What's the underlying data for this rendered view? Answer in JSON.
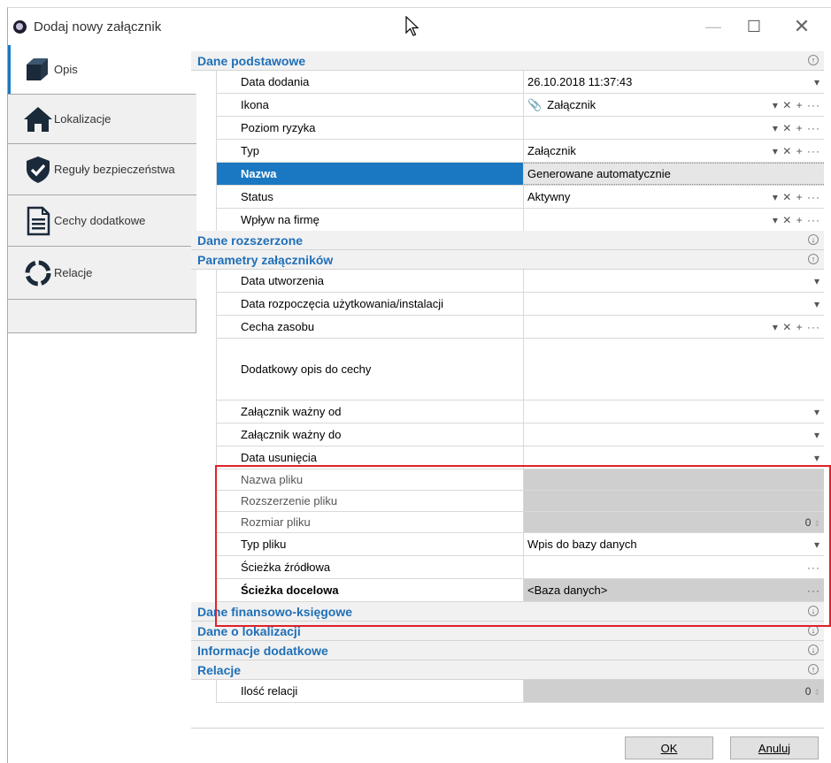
{
  "window": {
    "title": "Dodaj nowy załącznik"
  },
  "nav": {
    "tabs": [
      {
        "label": "Opis",
        "icon": "cube-icon",
        "active": true
      },
      {
        "label": "Lokalizacje",
        "icon": "house-icon",
        "active": false
      },
      {
        "label": "Reguły bezpieczeństwa",
        "icon": "shield-check-icon",
        "active": false
      },
      {
        "label": "Cechy dodatkowe",
        "icon": "document-icon",
        "active": false
      },
      {
        "label": "Relacje",
        "icon": "ring-icon",
        "active": false
      }
    ]
  },
  "groups": {
    "basic": {
      "label": "Dane podstawowe",
      "expanded": true
    },
    "extended": {
      "label": "Dane rozszerzone",
      "expanded": false
    },
    "params": {
      "label": "Parametry załączników",
      "expanded": true
    },
    "finance": {
      "label": "Dane finansowo-księgowe",
      "expanded": false
    },
    "location": {
      "label": "Dane o lokalizacji",
      "expanded": false
    },
    "info": {
      "label": "Informacje dodatkowe",
      "expanded": false
    },
    "relations": {
      "label": "Relacje",
      "expanded": true
    }
  },
  "basic_rows": [
    {
      "name": "Data dodania",
      "value": "26.10.2018 11:37:43"
    },
    {
      "name": "Ikona",
      "value": "Załącznik"
    },
    {
      "name": "Poziom ryzyka",
      "value": ""
    },
    {
      "name": "Typ",
      "value": "Załącznik"
    },
    {
      "name": "Nazwa",
      "value": "Generowane automatycznie"
    },
    {
      "name": "Status",
      "value": "Aktywny"
    },
    {
      "name": "Wpływ na firmę",
      "value": ""
    }
  ],
  "params_rows": [
    {
      "name": "Data utworzenia",
      "value": ""
    },
    {
      "name": "Data rozpoczęcia użytkowania/instalacji",
      "value": ""
    },
    {
      "name": "Cecha zasobu",
      "value": ""
    },
    {
      "name": "Dodatkowy opis do cechy",
      "value": ""
    },
    {
      "name": "Załącznik ważny od",
      "value": ""
    },
    {
      "name": "Załącznik ważny do",
      "value": ""
    },
    {
      "name": "Data usunięcia",
      "value": ""
    },
    {
      "name": "Nazwa pliku",
      "value": ""
    },
    {
      "name": "Rozszerzenie pliku",
      "value": ""
    },
    {
      "name": "Rozmiar pliku",
      "value": "0"
    },
    {
      "name": "Typ pliku",
      "value": "Wpis do bazy danych"
    },
    {
      "name": "Ścieżka źródłowa",
      "value": ""
    },
    {
      "name": "Ścieżka docelowa",
      "value": "<Baza danych>"
    }
  ],
  "relations_rows": [
    {
      "name": "Ilość relacji",
      "value": "0"
    }
  ],
  "controls": {
    "dropdown": "▾",
    "full": "▾ ✕ + ···",
    "ellipsis": "···",
    "spin": "⇕"
  },
  "buttons": {
    "ok": "OK",
    "cancel": "Anuluj"
  },
  "colors": {
    "accent": "#1a78c2",
    "group_text": "#1f6fb8",
    "highlight": "#e0202a"
  }
}
